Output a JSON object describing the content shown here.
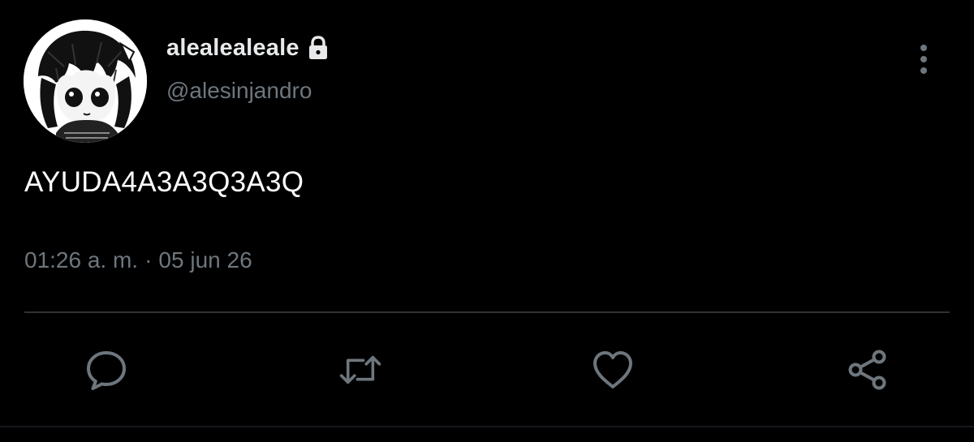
{
  "user": {
    "display_name": "alealealeale",
    "handle": "@alesinjandro",
    "protected": true
  },
  "tweet": {
    "text": "AYUDA4A3A3Q3A3Q",
    "time": "01:26 a. m.",
    "separator": "·",
    "date": "05 jun 26"
  },
  "icons": {
    "lock": "lock-icon",
    "more": "more-vertical-icon",
    "reply": "reply-icon",
    "retweet": "retweet-icon",
    "like": "heart-icon",
    "share": "share-icon"
  },
  "colors": {
    "background": "#000000",
    "primary_text": "#e7e9ea",
    "secondary_text": "#6e767d",
    "divider": "#2f3336"
  }
}
